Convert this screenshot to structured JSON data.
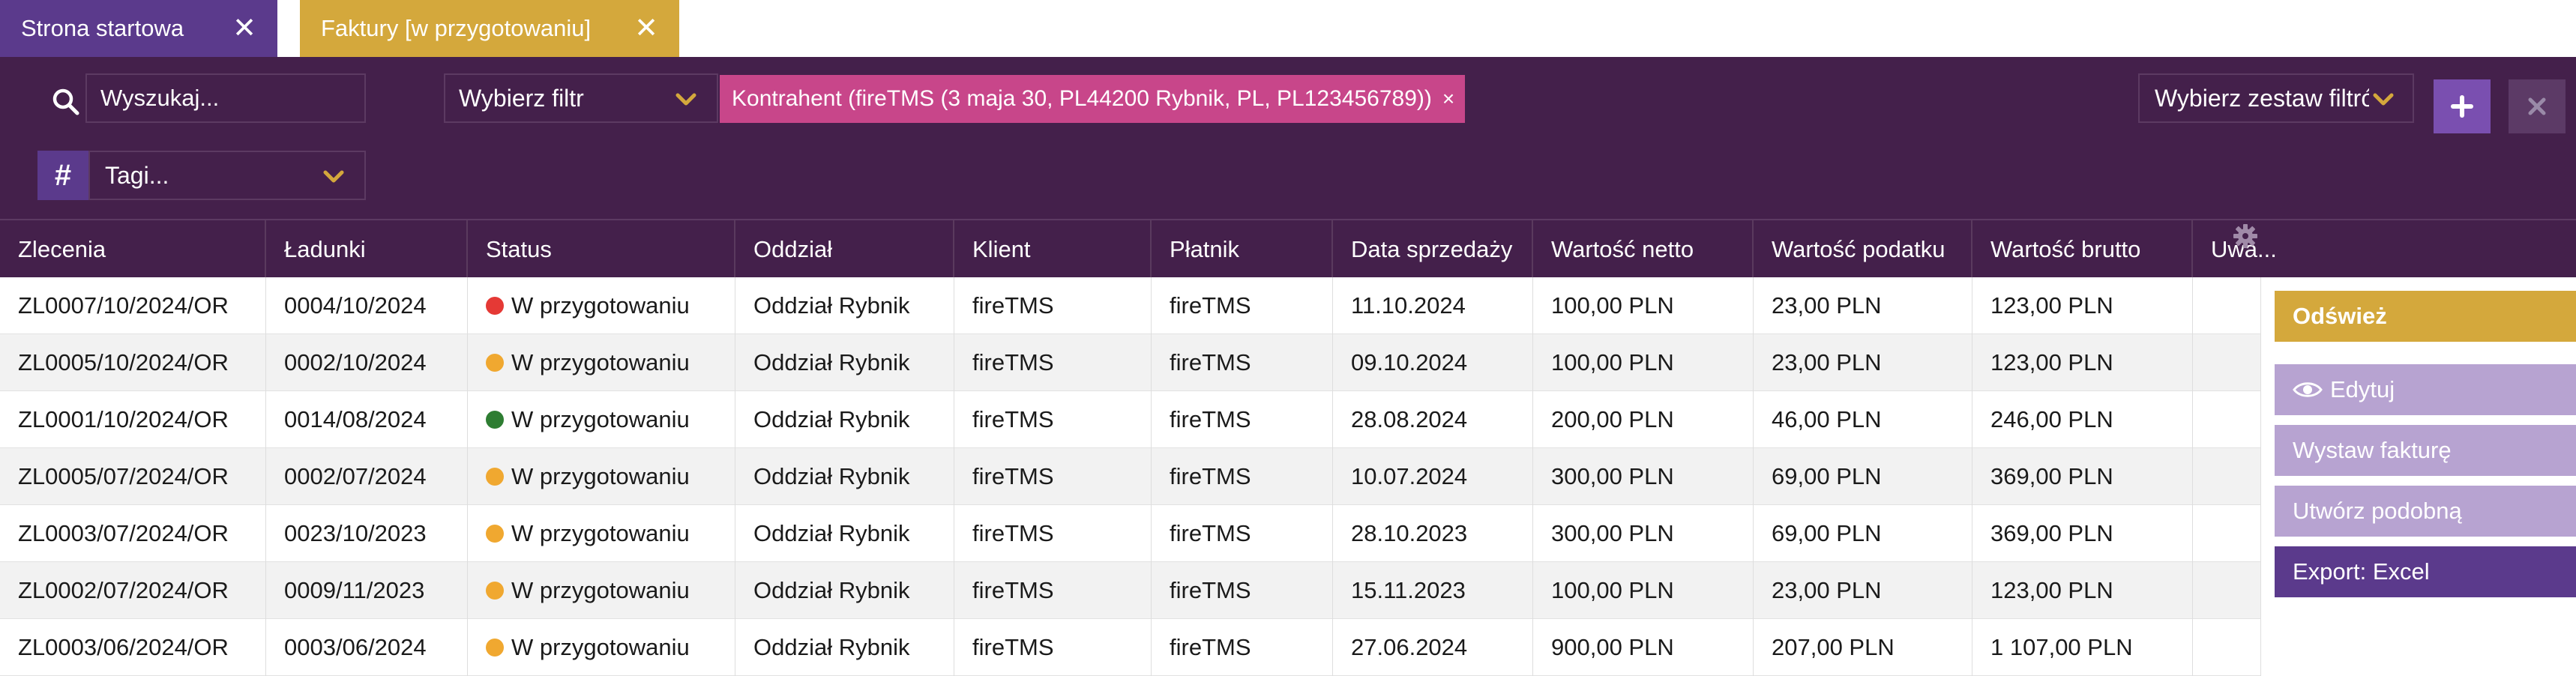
{
  "tabs": [
    {
      "label": "Strona startowa",
      "close": "✕"
    },
    {
      "label": "Faktury [w przygotowaniu]",
      "close": "✕"
    }
  ],
  "filters": {
    "search_placeholder": "Wyszukaj...",
    "filter_select": "Wybierz filtr",
    "active_filter": "Kontrahent (fireTMS (3 maja 30, PL44200 Rybnik, PL, PL123456789))",
    "active_filter_remove": "×",
    "filter_set_select": "Wybierz zestaw filtrów",
    "tags_select": "Tagi...",
    "tag_symbol": "#"
  },
  "table": {
    "columns": [
      "Zlecenia",
      "Ładunki",
      "Status",
      "Oddział",
      "Klient",
      "Płatnik",
      "Data sprzedaży",
      "Wartość netto",
      "Wartość podatku",
      "Wartość brutto",
      "Uwa..."
    ],
    "rows": [
      {
        "zlecenia": "ZL0007/10/2024/OR",
        "ladunki": "0004/10/2024",
        "status": "W przygotowaniu",
        "status_color": "#e53935",
        "oddzial": "Oddział Rybnik",
        "klient": "fireTMS",
        "platnik": "fireTMS",
        "data": "11.10.2024",
        "netto": "100,00 PLN",
        "podatek": "23,00 PLN",
        "brutto": "123,00 PLN",
        "uwagi": ""
      },
      {
        "zlecenia": "ZL0005/10/2024/OR",
        "ladunki": "0002/10/2024",
        "status": "W przygotowaniu",
        "status_color": "#f0a830",
        "oddzial": "Oddział Rybnik",
        "klient": "fireTMS",
        "platnik": "fireTMS",
        "data": "09.10.2024",
        "netto": "100,00 PLN",
        "podatek": "23,00 PLN",
        "brutto": "123,00 PLN",
        "uwagi": ""
      },
      {
        "zlecenia": "ZL0001/10/2024/OR",
        "ladunki": "0014/08/2024",
        "status": "W przygotowaniu",
        "status_color": "#2e7d32",
        "oddzial": "Oddział Rybnik",
        "klient": "fireTMS",
        "platnik": "fireTMS",
        "data": "28.08.2024",
        "netto": "200,00 PLN",
        "podatek": "46,00 PLN",
        "brutto": "246,00 PLN",
        "uwagi": ""
      },
      {
        "zlecenia": "ZL0005/07/2024/OR",
        "ladunki": "0002/07/2024",
        "status": "W przygotowaniu",
        "status_color": "#f0a830",
        "oddzial": "Oddział Rybnik",
        "klient": "fireTMS",
        "platnik": "fireTMS",
        "data": "10.07.2024",
        "netto": "300,00 PLN",
        "podatek": "69,00 PLN",
        "brutto": "369,00 PLN",
        "uwagi": ""
      },
      {
        "zlecenia": "ZL0003/07/2024/OR",
        "ladunki": "0023/10/2023",
        "status": "W przygotowaniu",
        "status_color": "#f0a830",
        "oddzial": "Oddział Rybnik",
        "klient": "fireTMS",
        "platnik": "fireTMS",
        "data": "28.10.2023",
        "netto": "300,00 PLN",
        "podatek": "69,00 PLN",
        "brutto": "369,00 PLN",
        "uwagi": ""
      },
      {
        "zlecenia": "ZL0002/07/2024/OR",
        "ladunki": "0009/11/2023",
        "status": "W przygotowaniu",
        "status_color": "#f0a830",
        "oddzial": "Oddział Rybnik",
        "klient": "fireTMS",
        "platnik": "fireTMS",
        "data": "15.11.2023",
        "netto": "100,00 PLN",
        "podatek": "23,00 PLN",
        "brutto": "123,00 PLN",
        "uwagi": ""
      },
      {
        "zlecenia": "ZL0003/06/2024/OR",
        "ladunki": "0003/06/2024",
        "status": "W przygotowaniu",
        "status_color": "#f0a830",
        "oddzial": "Oddział Rybnik",
        "klient": "fireTMS",
        "platnik": "fireTMS",
        "data": "27.06.2024",
        "netto": "900,00 PLN",
        "podatek": "207,00 PLN",
        "brutto": "1 107,00 PLN",
        "uwagi": ""
      }
    ]
  },
  "actions": {
    "refresh": "Odśwież",
    "edit": "Edytuj",
    "issue_invoice": "Wystaw fakturę",
    "create_similar": "Utwórz podobną",
    "export": "Export: Excel"
  },
  "icons": {
    "search": "search-icon",
    "chevron": "chevron-down-icon",
    "add": "plus-icon",
    "clear": "close-icon",
    "tag": "hash-icon",
    "settings": "gear-icon",
    "view": "eye-icon"
  },
  "colors": {
    "brand_purple": "#5b3a8c",
    "brand_dark": "#44204b",
    "accent_gold": "#d4a83c",
    "chip_pink": "#c8468a",
    "action_lavender": "#b7a3d1"
  }
}
